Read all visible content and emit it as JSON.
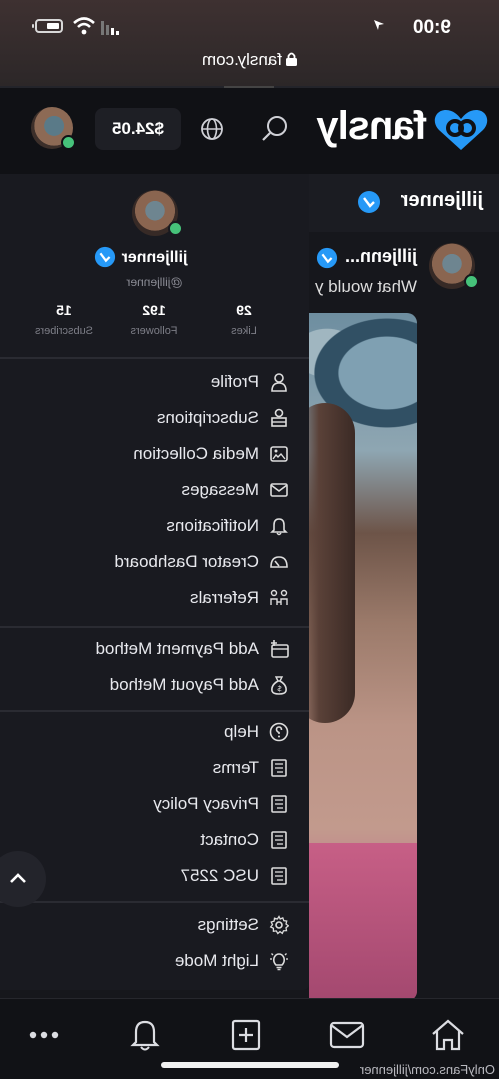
{
  "status_bar": {
    "time": "9:00",
    "url": "fansly.com"
  },
  "header": {
    "logo_text": "fansly",
    "balance": "$24.05",
    "icons": [
      "search-icon",
      "globe-icon"
    ]
  },
  "profile": {
    "title": "jilljenner",
    "post_author": "jilljenn...",
    "post_caption": "What would y"
  },
  "drawer": {
    "display_name": "jilljenner",
    "handle": "@jilljenner",
    "stats": [
      {
        "value": "29",
        "label": "Likes"
      },
      {
        "value": "192",
        "label": "Followers"
      },
      {
        "value": "15",
        "label": "Subscribers"
      }
    ],
    "menu_main": [
      {
        "label": "Profile",
        "icon": "user-icon"
      },
      {
        "label": "Subscriptions",
        "icon": "subscriptions-icon"
      },
      {
        "label": "Media Collection",
        "icon": "media-icon"
      },
      {
        "label": "Messages",
        "icon": "envelope-icon"
      },
      {
        "label": "Notifications",
        "icon": "bell-icon"
      },
      {
        "label": "Creator Dashboard",
        "icon": "dashboard-icon"
      },
      {
        "label": "Referrals",
        "icon": "referrals-icon"
      }
    ],
    "menu_payment": [
      {
        "label": "Add Payment Method",
        "icon": "card-add-icon"
      },
      {
        "label": "Add Payout Method",
        "icon": "money-bag-icon"
      }
    ],
    "menu_info": [
      {
        "label": "Help",
        "icon": "help-icon"
      },
      {
        "label": "Terms",
        "icon": "document-icon"
      },
      {
        "label": "Privacy Policy",
        "icon": "document-icon"
      },
      {
        "label": "Contact",
        "icon": "document-icon"
      },
      {
        "label": "USC 2257",
        "icon": "document-icon"
      }
    ],
    "menu_settings": [
      {
        "label": "Settings",
        "icon": "gear-icon"
      },
      {
        "label": "Light Mode",
        "icon": "lightbulb-icon"
      }
    ]
  },
  "footer": {
    "url_text": "OnlyFans.com/jilljenner"
  },
  "colors": {
    "accent": "#2699f7",
    "background": "#16171c",
    "drawer": "#191a20",
    "online": "#46c27a"
  }
}
